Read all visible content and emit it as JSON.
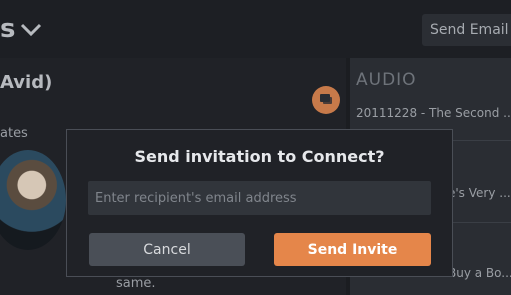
{
  "header": {
    "title_fragment": "s",
    "send_email_label": "Send Email"
  },
  "profile": {
    "name_fragment": "Avid)",
    "updates_fragment": "ates",
    "bottom_text_fragment": "same."
  },
  "media": {
    "section_label": "AUDIO",
    "items": [
      "20111228 - The Second ...",
      "e's Very ...",
      "Buy a Bo..."
    ]
  },
  "modal": {
    "title": "Send invitation to Connect?",
    "email_placeholder": "Enter recipient's email address",
    "email_value": "",
    "cancel_label": "Cancel",
    "send_label": "Send Invite"
  },
  "colors": {
    "accent": "#e5864a",
    "modal_bg": "#202227",
    "input_bg": "#31353b",
    "cancel_bg": "#4a4f57"
  }
}
